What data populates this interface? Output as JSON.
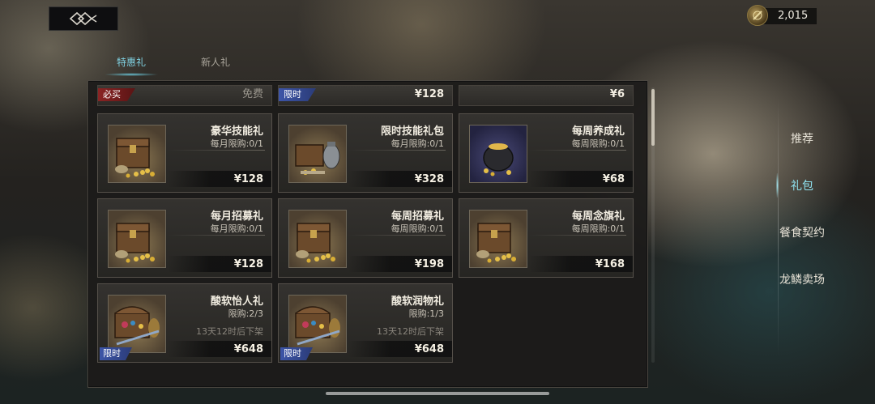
{
  "currency": {
    "value": "2,015",
    "icon": "coin-icon"
  },
  "tabs": [
    {
      "label": "特惠礼",
      "active": true
    },
    {
      "label": "新人礼",
      "active": false
    }
  ],
  "top_strips": [
    {
      "tag": "必买",
      "price": "免费"
    },
    {
      "tag": "限时",
      "price": "¥128"
    },
    {
      "tag": "",
      "price": "¥6"
    }
  ],
  "cards": [
    {
      "name": "豪华技能礼",
      "limit": "每月限购:0/1",
      "expire": "",
      "price": "¥128",
      "tag": "",
      "image": "treasure-chest-icon"
    },
    {
      "name": "限时技能礼包",
      "limit": "每月限购:0/1",
      "expire": "",
      "price": "¥328",
      "tag": "",
      "image": "treasure-vase-icon"
    },
    {
      "name": "每周养成礼",
      "limit": "每周限购:0/1",
      "expire": "",
      "price": "¥68",
      "tag": "",
      "image": "gold-pot-icon"
    },
    {
      "name": "每月招募礼",
      "limit": "每月限购:0/1",
      "expire": "",
      "price": "¥128",
      "tag": "",
      "image": "chest-icon"
    },
    {
      "name": "每周招募礼",
      "limit": "每周限购:0/1",
      "expire": "",
      "price": "¥198",
      "tag": "",
      "image": "chest-icon"
    },
    {
      "name": "每周念旗礼",
      "limit": "每周限购:0/1",
      "expire": "",
      "price": "¥168",
      "tag": "",
      "image": "chest-icon"
    },
    {
      "name": "酸软怡人礼",
      "limit": "限购:2/3",
      "expire": "13天12时后下架",
      "price": "¥648",
      "tag": "限时",
      "image": "jewel-chest-icon"
    },
    {
      "name": "酸软润物礼",
      "limit": "限购:1/3",
      "expire": "13天12时后下架",
      "price": "¥648",
      "tag": "限时",
      "image": "jewel-chest-icon"
    }
  ],
  "side_menu": [
    {
      "label": "推荐",
      "active": false
    },
    {
      "label": "礼包",
      "active": true
    },
    {
      "label": "餐食契约",
      "active": false
    },
    {
      "label": "龙鳞卖场",
      "active": false
    }
  ]
}
